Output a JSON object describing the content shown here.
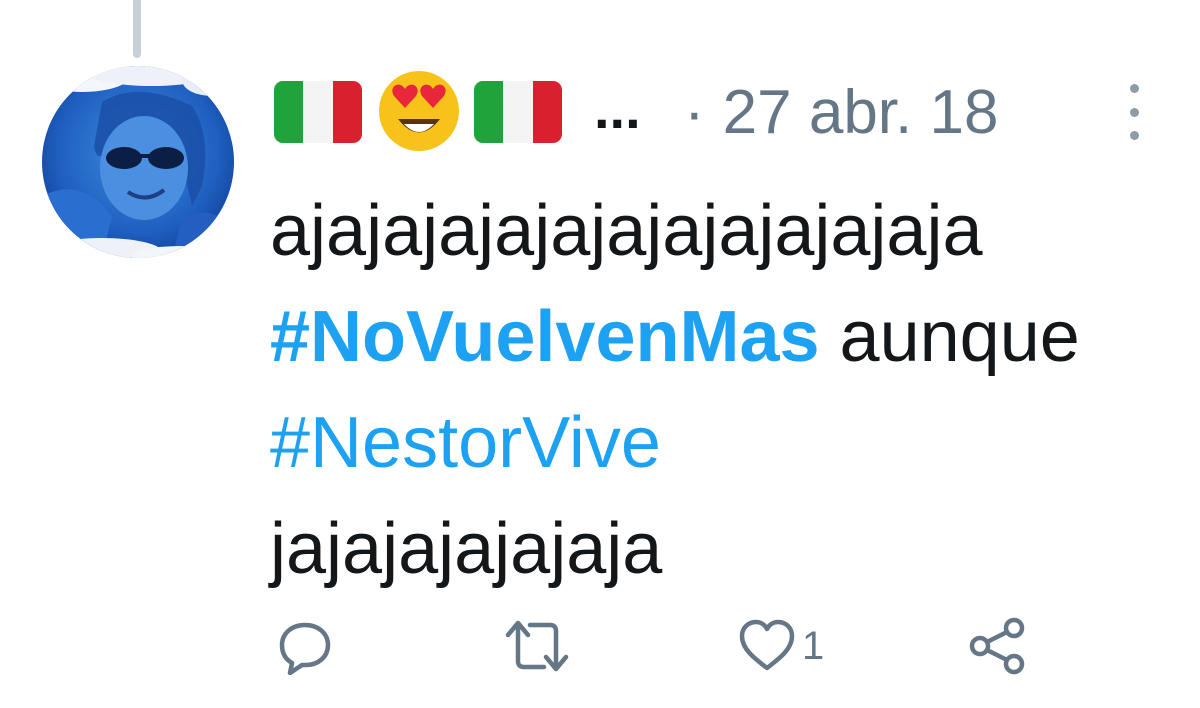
{
  "tweet": {
    "author": {
      "display_name_icons": [
        "italy-flag",
        "heart-eyes-emoji",
        "italy-flag"
      ],
      "name_truncation": "..."
    },
    "separator": "·",
    "date": "27 abr. 18",
    "text_lines": [
      {
        "segments": [
          {
            "type": "text",
            "value": "ajajajajajajajajajajajaja"
          }
        ]
      },
      {
        "segments": [
          {
            "type": "hashtag",
            "value": "#NoVuelvenMas"
          },
          {
            "type": "text",
            "value": " aunque"
          }
        ]
      },
      {
        "segments": [
          {
            "type": "hashtag",
            "value": "#NestorVive"
          }
        ]
      },
      {
        "segments": [
          {
            "type": "text",
            "value": "jajajajajajaja"
          }
        ]
      }
    ],
    "hashtag_1": "#NoVuelvenMas",
    "text_1": "ajajajajajajajajajajajaja",
    "text_2": " aunque",
    "hashtag_2": "#NestorVive",
    "text_3": "jajajajajajaja",
    "actions": {
      "reply_icon": "reply-icon",
      "retweet_icon": "retweet-icon",
      "like_icon": "heart-icon",
      "like_count": "1",
      "share_icon": "share-icon"
    }
  },
  "colors": {
    "text": "#14171a",
    "secondary": "#657786",
    "link": "#1da1f2",
    "thread_line": "#c7d0d8",
    "flag_green": "#1fa33a",
    "flag_white": "#f4f4f4",
    "flag_red": "#d8202e"
  }
}
